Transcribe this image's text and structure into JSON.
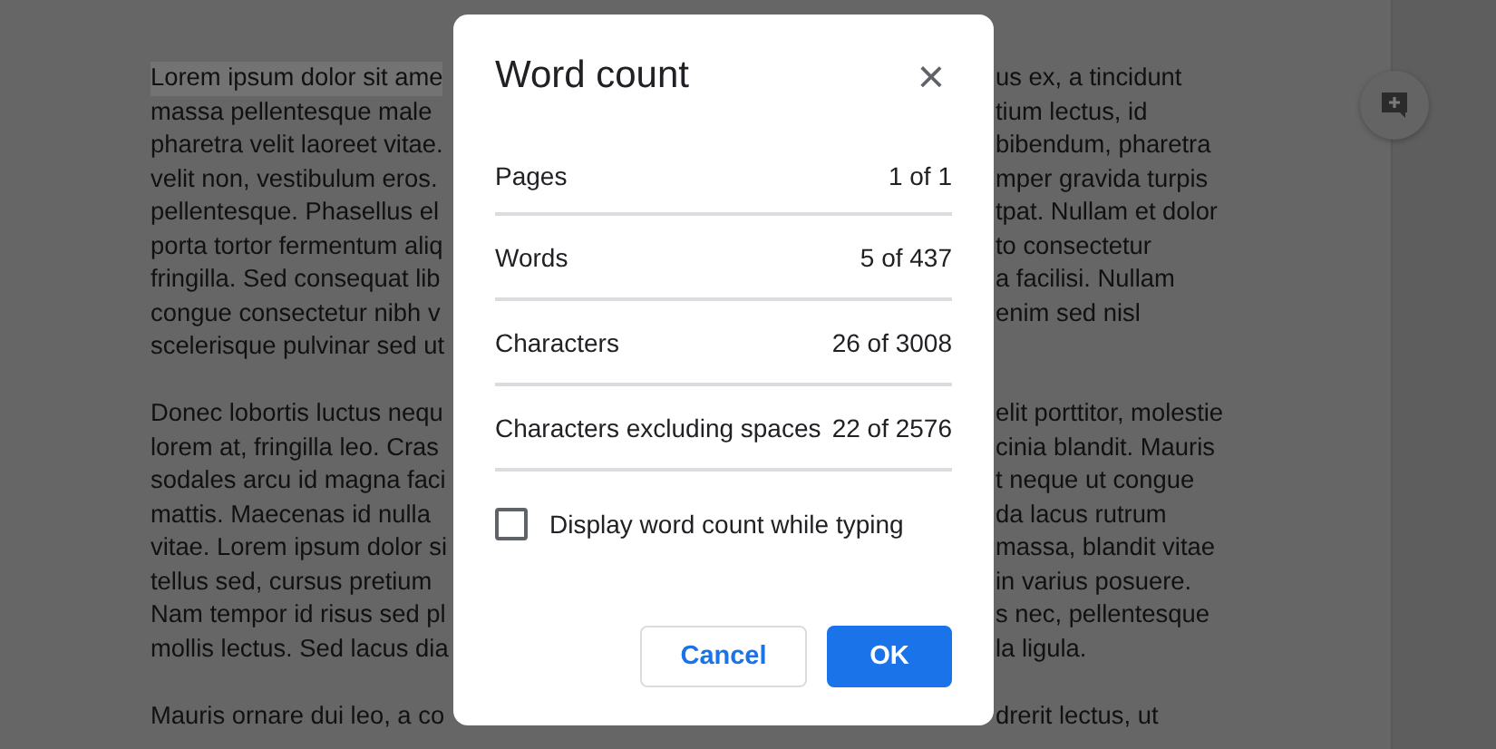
{
  "document": {
    "paragraphs": [
      {
        "lines": [
          {
            "left": "Lorem ipsum dolor sit ame",
            "right": "us ex, a tincidunt",
            "selected": true
          },
          {
            "left": "massa pellentesque male",
            "right": "tium lectus, id",
            "selected": false
          },
          {
            "left": "pharetra velit laoreet vitae.",
            "right": "bibendum, pharetra",
            "selected": false
          },
          {
            "left": "velit non, vestibulum eros.",
            "right": "mper gravida turpis",
            "selected": false
          },
          {
            "left": "pellentesque. Phasellus el",
            "right": "tpat. Nullam et dolor",
            "selected": false
          },
          {
            "left": "porta tortor fermentum aliq",
            "right": "to consectetur",
            "selected": false
          },
          {
            "left": "fringilla. Sed consequat lib",
            "right": "a facilisi. Nullam",
            "selected": false
          },
          {
            "left": "congue consectetur nibh v",
            "right": "enim sed nisl",
            "selected": false
          },
          {
            "left": "scelerisque pulvinar sed ut",
            "selected": false
          }
        ]
      },
      {
        "lines": [
          {
            "left": "Donec lobortis luctus nequ",
            "right": "elit porttitor, molestie",
            "selected": false
          },
          {
            "left": "lorem at, fringilla leo. Cras",
            "right": "cinia blandit. Mauris",
            "selected": false
          },
          {
            "left": "sodales arcu id magna faci",
            "right": "t neque ut congue",
            "selected": false
          },
          {
            "left": "mattis. Maecenas id nulla",
            "right": "da lacus rutrum",
            "selected": false
          },
          {
            "left": "vitae. Lorem ipsum dolor si",
            "right": "massa, blandit vitae",
            "selected": false
          },
          {
            "left": "tellus sed, cursus pretium",
            "right": "in varius posuere.",
            "selected": false
          },
          {
            "left": "Nam tempor id risus sed pl",
            "right": "s nec, pellentesque",
            "selected": false
          },
          {
            "left": "mollis lectus. Sed lacus dia",
            "right": "la ligula.",
            "selected": false
          }
        ]
      },
      {
        "lines": [
          {
            "left": "Mauris ornare dui leo, a co",
            "right": "drerit lectus, ut",
            "selected": false
          }
        ]
      }
    ]
  },
  "dialog": {
    "title": "Word count",
    "close": "×",
    "stats": [
      {
        "label": "Pages",
        "value": "1 of 1"
      },
      {
        "label": "Words",
        "value": "5 of 437"
      },
      {
        "label": "Characters",
        "value": "26 of 3008"
      },
      {
        "label": "Characters excluding spaces",
        "value": "22 of 2576"
      }
    ],
    "option": {
      "label": "Display word count while typing",
      "checked": false
    },
    "buttons": [
      {
        "label": "Cancel",
        "kind": "secondary"
      },
      {
        "label": "OK",
        "kind": "primary"
      }
    ]
  }
}
